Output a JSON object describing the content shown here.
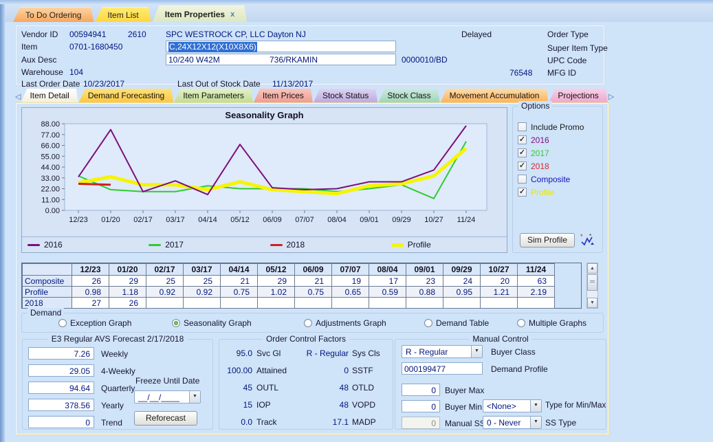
{
  "window": {
    "tabs": [
      {
        "label": "To Do Ordering",
        "c1": "#fdd4a2",
        "c2": "#f7a75e",
        "active": false,
        "closable": false
      },
      {
        "label": "Item List",
        "c1": "#ffec72",
        "c2": "#ffd73e",
        "active": false,
        "closable": false
      },
      {
        "label": "Item Properties",
        "c1": "#f0f4de",
        "c2": "#dce7bf",
        "active": true,
        "closable": true
      }
    ],
    "close_glyph": "x"
  },
  "header": {
    "vendor_label": "Vendor ID",
    "vendor_id": "00594941",
    "vendor_code": "2610",
    "vendor_name": "SPC WESTROCK CP, LLC Dayton NJ",
    "delayed": "Delayed",
    "order_type_label": "Order Type",
    "item_label": "Item",
    "item_id": "0701-1680450",
    "item_desc": "C,24X12X12(X10X8X6)",
    "super_item_type_label": "Super Item Type",
    "aux_desc_label": "Aux Desc",
    "aux_desc_1": "10/240 W42M",
    "aux_desc_2": "736/RKAMIN",
    "aux_code": "0000010/BD",
    "upc_label": "UPC Code",
    "warehouse_label": "Warehouse",
    "warehouse": "104",
    "mfg_id": "76548",
    "mfg_label": "MFG ID",
    "last_order_label": "Last Order Date",
    "last_order_date": "10/23/2017",
    "last_oos_label": "Last Out of Stock Date",
    "last_oos_date": "11/13/2017"
  },
  "subtabs": {
    "left_arrow": "◁",
    "right_arrow": "▷",
    "items": [
      {
        "label": "Item Detail",
        "c1": "#ffffff",
        "c2": "#f2efdd",
        "active": false
      },
      {
        "label": "Demand Forecasting",
        "c1": "#ffe27a",
        "c2": "#fcc846",
        "active": true
      },
      {
        "label": "Item Parameters",
        "c1": "#e3f1c4",
        "c2": "#c2dd96",
        "active": false
      },
      {
        "label": "Item Prices",
        "c1": "#f9c6bc",
        "c2": "#ef9c96",
        "active": false
      },
      {
        "label": "Stock Status",
        "c1": "#ded4f1",
        "c2": "#bcaade",
        "active": false
      },
      {
        "label": "Stock Class",
        "c1": "#cceadd",
        "c2": "#a0d5ba",
        "active": false
      },
      {
        "label": "Movement Accumulation",
        "c1": "#ffdca6",
        "c2": "#fcb35f",
        "active": false
      },
      {
        "label": "Projections",
        "c1": "#f9d0e7",
        "c2": "#efa8ce",
        "active": false
      }
    ]
  },
  "options": {
    "title": "Options",
    "items": [
      {
        "label": "Include Promo",
        "checked": false,
        "color": "#1a1a1a"
      },
      {
        "label": "2016",
        "checked": true,
        "color": "#7b0f7b"
      },
      {
        "label": "2017",
        "checked": true,
        "color": "#2ecc2e"
      },
      {
        "label": "2018",
        "checked": true,
        "color": "#d42a2a"
      },
      {
        "label": "Composite",
        "checked": false,
        "color": "#1414b4"
      },
      {
        "label": "Profile",
        "checked": true,
        "color": "#e8e800"
      }
    ],
    "sim_button": "Sim Profile"
  },
  "chart_data": {
    "type": "line",
    "title": "Seasonality Graph",
    "categories": [
      "12/23",
      "01/20",
      "02/17",
      "03/17",
      "04/14",
      "05/12",
      "06/09",
      "07/07",
      "08/04",
      "09/01",
      "09/29",
      "10/27",
      "11/24"
    ],
    "ylim": [
      0,
      88
    ],
    "ytick_labels": [
      "0.00",
      "11.00",
      "22.00",
      "33.00",
      "44.00",
      "55.00",
      "66.00",
      "77.00",
      "88.00"
    ],
    "grid": false,
    "legend_position": "bottom",
    "series": [
      {
        "name": "2016",
        "color": "#7b0f7b",
        "width": 2,
        "values": [
          34,
          82,
          19,
          30,
          16,
          67,
          23,
          21,
          22,
          29,
          29,
          41,
          86
        ]
      },
      {
        "name": "2017",
        "color": "#2ecc2e",
        "width": 2,
        "values": [
          35,
          21,
          19,
          19,
          25,
          22,
          22,
          22,
          19,
          22,
          26,
          12,
          70
        ]
      },
      {
        "name": "2018",
        "color": "#cc2222",
        "width": 3,
        "values": [
          27,
          26
        ]
      },
      {
        "name": "Profile",
        "color": "#f5f500",
        "width": 5,
        "values": [
          28,
          34,
          26,
          26,
          21,
          29,
          21,
          19,
          17,
          25,
          27,
          35,
          63
        ]
      }
    ]
  },
  "table": {
    "columns": [
      "",
      "12/23",
      "01/20",
      "02/17",
      "03/17",
      "04/14",
      "05/12",
      "06/09",
      "07/07",
      "08/04",
      "09/01",
      "09/29",
      "10/27",
      "11/24"
    ],
    "rows": [
      {
        "label": "Composite",
        "values": [
          "26",
          "29",
          "25",
          "25",
          "21",
          "29",
          "21",
          "19",
          "17",
          "23",
          "24",
          "20",
          "63"
        ]
      },
      {
        "label": "Profile",
        "values": [
          "0.98",
          "1.18",
          "0.92",
          "0.92",
          "0.75",
          "1.02",
          "0.75",
          "0.65",
          "0.59",
          "0.88",
          "0.95",
          "1.21",
          "2.19"
        ]
      },
      {
        "label": "2018",
        "values": [
          "27",
          "26",
          "",
          "",
          "",
          "",
          "",
          "",
          "",
          "",
          "",
          "",
          ""
        ]
      }
    ]
  },
  "demand": {
    "title": "Demand",
    "options": [
      {
        "label": "Exception Graph",
        "selected": false
      },
      {
        "label": "Seasonality Graph",
        "selected": true
      },
      {
        "label": "Adjustments Graph",
        "selected": false
      },
      {
        "label": "Demand Table",
        "selected": false
      },
      {
        "label": "Multiple Graphs",
        "selected": false
      }
    ]
  },
  "forecast": {
    "title": "E3 Regular AVS Forecast  2/17/2018",
    "rows": [
      {
        "value": "7.26",
        "label": "Weekly"
      },
      {
        "value": "29.05",
        "label": "4-Weekly"
      },
      {
        "value": "94.64",
        "label": "Quarterly"
      },
      {
        "value": "378.56",
        "label": "Yearly"
      },
      {
        "value": "0",
        "label": "Trend"
      }
    ],
    "freeze_label": "Freeze Until Date",
    "freeze_value": "__/__/____",
    "button": "Reforecast"
  },
  "order_control": {
    "title": "Order Control Factors",
    "left": [
      {
        "value": "95.0",
        "label": "Svc Gl"
      },
      {
        "value": "100.00",
        "label": "Attained"
      },
      {
        "value": "45",
        "label": "OUTL"
      },
      {
        "value": "15",
        "label": "IOP"
      },
      {
        "value": "0.0",
        "label": "Track"
      }
    ],
    "right": [
      {
        "value": "R - Regular",
        "label": "Sys Cls"
      },
      {
        "value": "0",
        "label": "SSTF"
      },
      {
        "value": "48",
        "label": "OTLD"
      },
      {
        "value": "48",
        "label": "VOPD"
      },
      {
        "value": "17.1",
        "label": "MADP"
      }
    ]
  },
  "manual": {
    "title": "Manual Control",
    "buyer_class": {
      "value": "R - Regular",
      "label": "Buyer Class"
    },
    "demand_profile": {
      "value": "000199477",
      "label": "Demand Profile"
    },
    "buyer_max": {
      "value": "0",
      "label": "Buyer Max"
    },
    "buyer_min": {
      "value": "0",
      "label": "Buyer Min"
    },
    "minmax_type": {
      "value": "<None>",
      "label": "Type for Min/Max"
    },
    "manual_ss": {
      "value": "0",
      "label": "Manual SS"
    },
    "ss_type": {
      "value": "0 - Never",
      "label": "SS Type"
    }
  }
}
